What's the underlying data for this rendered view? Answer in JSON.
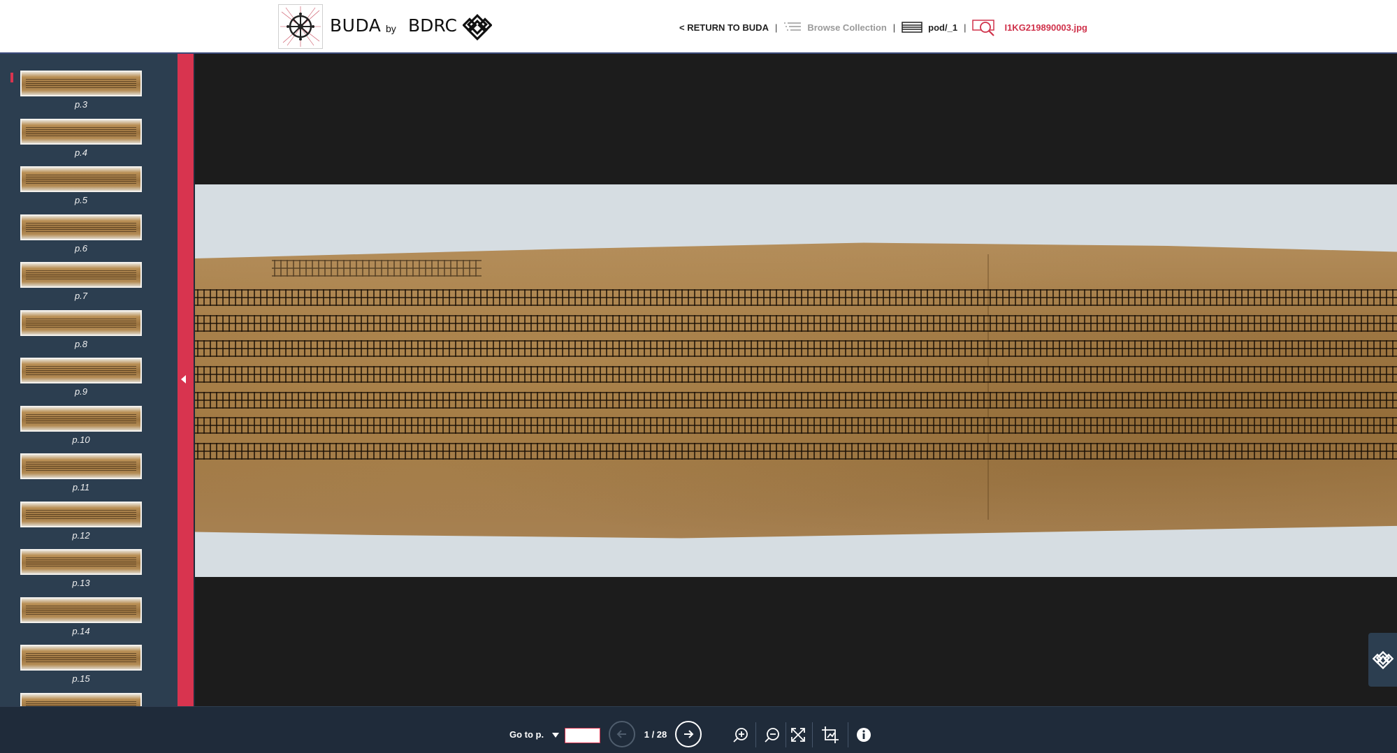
{
  "header": {
    "brand": "BUDA",
    "by": "by",
    "org": "BDRC",
    "nav": {
      "return_label": "<  RETURN TO BUDA",
      "separator": "|",
      "browse_label": "Browse Collection",
      "volume_label": "pod/_1",
      "image_name": "I1KG219890003.jpg"
    }
  },
  "sidebar": {
    "thumbnails": [
      {
        "label": "p.3"
      },
      {
        "label": "p.4"
      },
      {
        "label": "p.5"
      },
      {
        "label": "p.6"
      },
      {
        "label": "p.7"
      },
      {
        "label": "p.8"
      },
      {
        "label": "p.9"
      },
      {
        "label": "p.10"
      },
      {
        "label": "p.11"
      },
      {
        "label": "p.12"
      },
      {
        "label": "p.13"
      },
      {
        "label": "p.14"
      },
      {
        "label": "p.15"
      }
    ]
  },
  "bottombar": {
    "goto_label": "Go to p.",
    "goto_value": "",
    "page_indicator": "1 / 28"
  },
  "colors": {
    "accent": "#d8344f",
    "sidebar_bg": "#2c3e50",
    "bar_bg": "#1f2b3a",
    "viewer_bg": "#1c1c1c"
  },
  "icons": [
    "logo-dharma-wheel-icon",
    "endless-knot-icon",
    "chevron-left-icon",
    "list-icon",
    "volume-icon",
    "image-search-icon",
    "arrow-left-icon",
    "arrow-right-icon",
    "zoom-in-icon",
    "zoom-out-icon",
    "fullscreen-icon",
    "crop-icon",
    "info-icon"
  ]
}
